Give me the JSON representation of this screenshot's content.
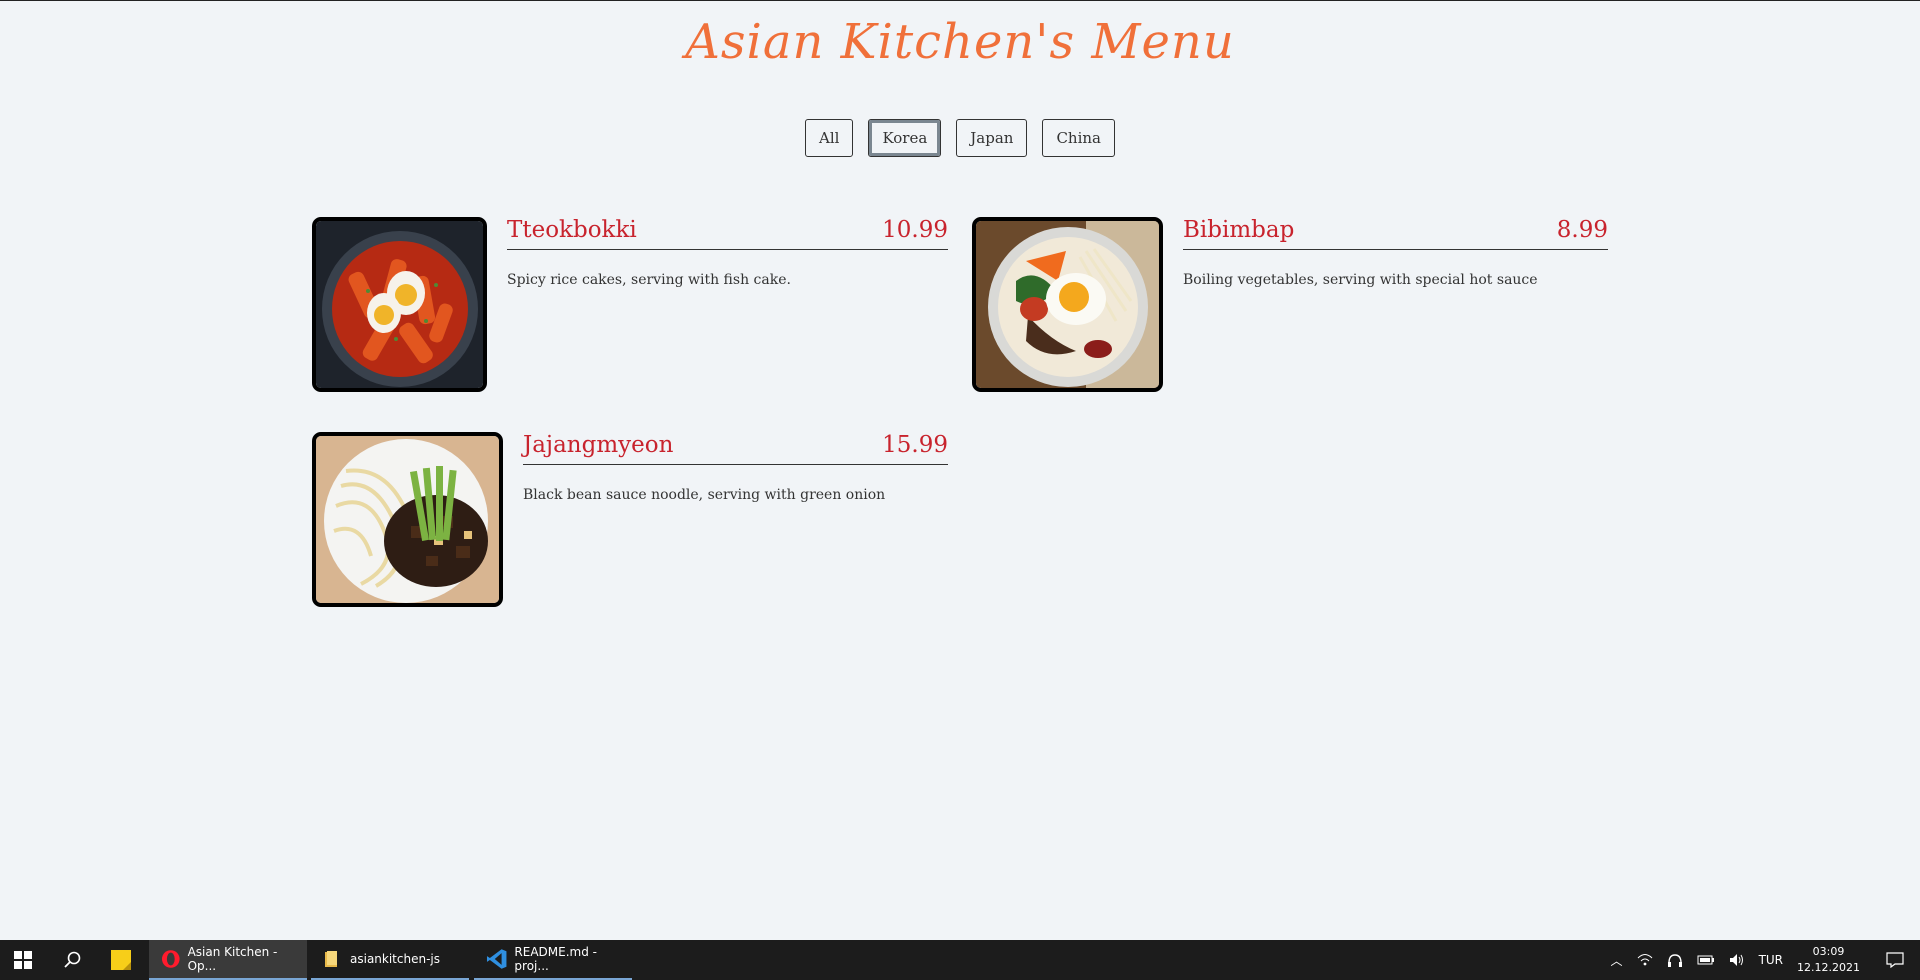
{
  "page": {
    "title": "Asian Kitchen's Menu"
  },
  "filters": [
    {
      "label": "All",
      "active": false
    },
    {
      "label": "Korea",
      "active": true
    },
    {
      "label": "Japan",
      "active": false
    },
    {
      "label": "China",
      "active": false
    }
  ],
  "menu": [
    {
      "name": "Tteokbokki",
      "price": "10.99",
      "desc": "Spicy rice cakes, serving with fish cake."
    },
    {
      "name": "Bibimbap",
      "price": "8.99",
      "desc": "Boiling vegetables, serving with special hot sauce"
    },
    {
      "name": "Jajangmyeon",
      "price": "15.99",
      "desc": "Black bean sauce noodle, serving with green onion"
    }
  ],
  "taskbar": {
    "apps": [
      {
        "label": "Asian Kitchen - Op...",
        "icon": "opera-icon"
      },
      {
        "label": "asiankitchen-js",
        "icon": "folder-icon"
      },
      {
        "label": "README.md - proj...",
        "icon": "vscode-icon"
      }
    ],
    "lang": "TUR",
    "time": "03:09",
    "date": "12.12.2021"
  }
}
